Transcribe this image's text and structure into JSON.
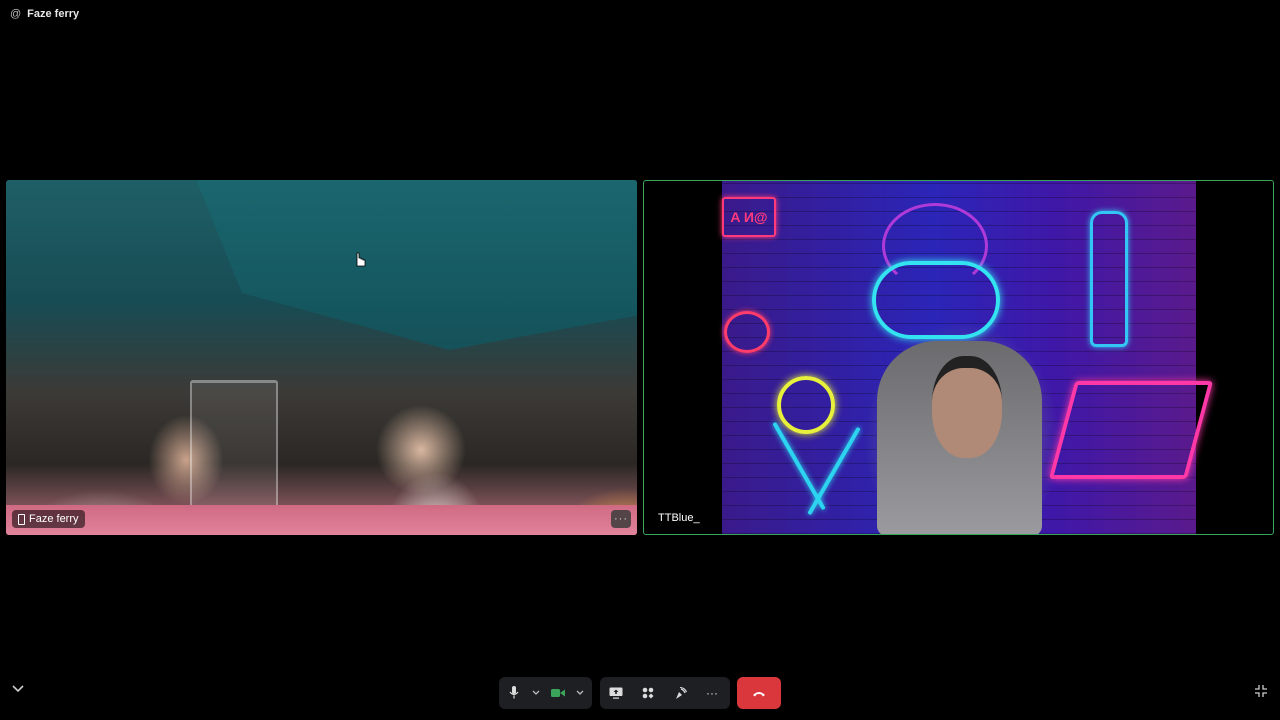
{
  "header": {
    "icon": "at-icon",
    "title": "Faze ferry"
  },
  "tiles": [
    {
      "name": "Faze ferry",
      "device_icon": "phone-icon",
      "more_label": "···"
    },
    {
      "name": "TTBlue_",
      "background_sign": "A И@"
    }
  ],
  "controls": {
    "mic_icon": "microphone-icon",
    "mic_chevron": "chevron-down-icon",
    "camera_icon": "camera-icon",
    "camera_chevron": "chevron-down-icon",
    "share_icon": "screen-share-icon",
    "activities_icon": "activities-icon",
    "soundboard_icon": "soundboard-icon",
    "more_label": "···",
    "hangup_icon": "hang-up-icon",
    "colors": {
      "hangup": "#da373c",
      "camera_active": "#3ba55c",
      "speaking_border": "#3ba55c"
    }
  },
  "corners": {
    "left_icon": "chevron-down-icon",
    "right_icon": "exit-fullscreen-icon"
  }
}
